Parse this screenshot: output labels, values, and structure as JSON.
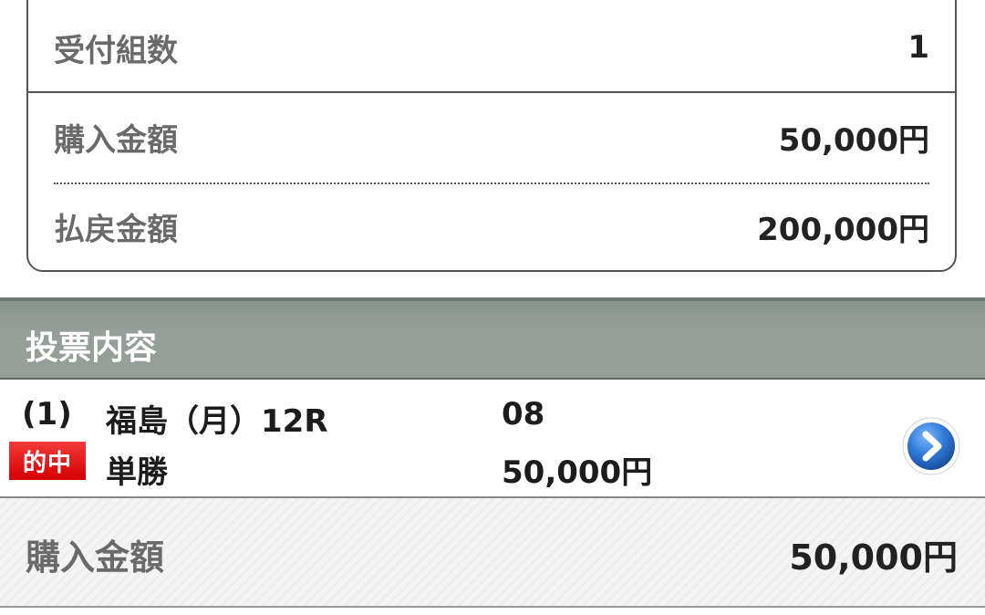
{
  "summary": {
    "count_label": "受付組数",
    "count_value": "1",
    "purchase_label": "購入金額",
    "purchase_value": "50,000円",
    "payout_label": "払戻金額",
    "payout_value": "200,000円"
  },
  "section": {
    "title": "投票内容"
  },
  "bet": {
    "index": "(1)",
    "race": "福島（月）12R",
    "horse_number": "08",
    "badge": "的中",
    "bet_type": "単勝",
    "amount": "50,000円",
    "detail_icon": "chevron-right-circle-icon"
  },
  "total": {
    "label": "購入金額",
    "value": "50,000円"
  },
  "colors": {
    "section_header": "#959e98",
    "hit_badge": "#e00000",
    "detail_button": "#2a72c8"
  }
}
